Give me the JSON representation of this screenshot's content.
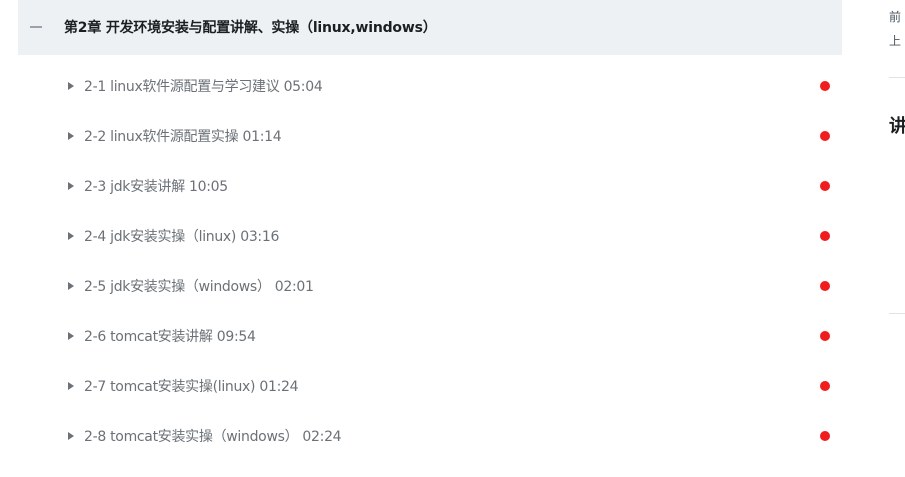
{
  "chapter": {
    "title": "第2章 开发环境安装与配置讲解、实操（linux,windows）",
    "collapse_icon": "minus-icon",
    "lessons": [
      {
        "label": "2-1 linux软件源配置与学习建议 05:04"
      },
      {
        "label": "2-2 linux软件源配置实操 01:14"
      },
      {
        "label": "2-3 jdk安装讲解 10:05"
      },
      {
        "label": "2-4 jdk安装实操（linux) 03:16"
      },
      {
        "label": "2-5 jdk安装实操（windows） 02:01"
      },
      {
        "label": "2-6 tomcat安装讲解 09:54"
      },
      {
        "label": "2-7 tomcat安装实操(linux) 01:24"
      },
      {
        "label": "2-8 tomcat安装实操（windows） 02:24"
      }
    ],
    "lesson_icon": "play-triangle-icon",
    "status_color": "#ef1d1d"
  },
  "right_panel": {
    "line1": "前",
    "line2": "上",
    "heading": "讲"
  },
  "colors": {
    "header_bg": "#eef1f3",
    "title_text": "#1c1f21",
    "lesson_text": "#6b7177",
    "status_dot": "#ef1d1d"
  }
}
